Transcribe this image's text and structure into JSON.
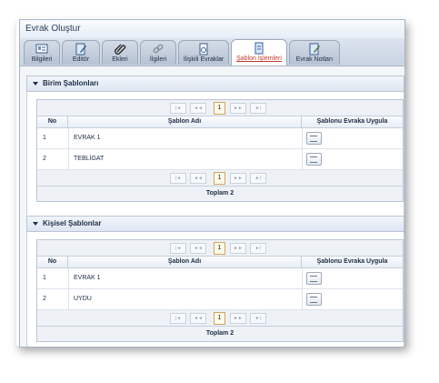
{
  "window": {
    "title": "Evrak Oluştur"
  },
  "tabs": [
    {
      "label": "Bilgileri",
      "icon": "info-card-icon"
    },
    {
      "label": "Editör",
      "icon": "edit-icon"
    },
    {
      "label": "Ekleri",
      "icon": "paperclip-icon"
    },
    {
      "label": "İlgileri",
      "icon": "link-icon"
    },
    {
      "label": "İlişkili Evraklar",
      "icon": "related-docs-icon"
    },
    {
      "label": "Şablon İşlemleri",
      "icon": "template-icon",
      "active": true
    },
    {
      "label": "Evrak Notları",
      "icon": "notes-icon"
    }
  ],
  "birim": {
    "title": "Birim Şablonları",
    "columns": {
      "no": "No",
      "name": "Şablon Adı",
      "apply": "Şablonu Evraka Uygula"
    },
    "rows": [
      {
        "no": "1",
        "name": "EVRAK 1"
      },
      {
        "no": "2",
        "name": "TEBLİGAT"
      }
    ],
    "page": "1",
    "total": "Toplam 2"
  },
  "kisisel": {
    "title": "Kişisel Şablonlar",
    "columns": {
      "no": "No",
      "name": "Şablon Adı",
      "apply": "Şablonu Evraka Uygula"
    },
    "rows": [
      {
        "no": "1",
        "name": "EVRAK 1"
      },
      {
        "no": "2",
        "name": "UYDU"
      }
    ],
    "page": "1",
    "total": "Toplam 2"
  },
  "pager": {
    "first": "|◄",
    "prev": "◄◄",
    "next": "►►",
    "last": "►|"
  },
  "colors": {
    "active_tab_text": "#c0392b",
    "header_text": "#1c2c44",
    "border": "#b9c6d6"
  }
}
